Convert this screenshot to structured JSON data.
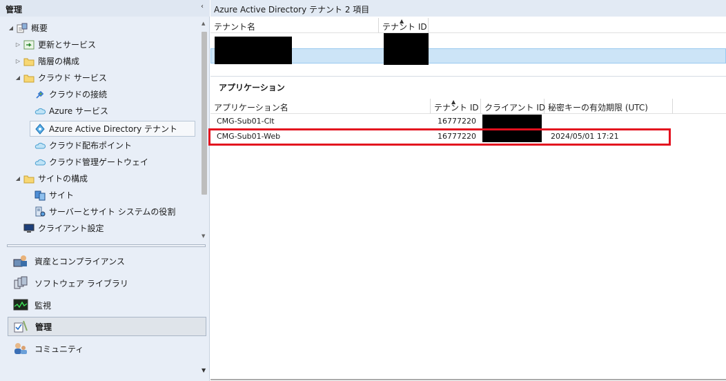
{
  "left": {
    "header": "管理",
    "collapse_icon": "‹",
    "tree": [
      {
        "label": "概要",
        "icon": "overview-icon",
        "expander": "▲",
        "indent": 0
      },
      {
        "label": "更新とサービス",
        "icon": "updates-icon",
        "expander": "▷",
        "indent": 1
      },
      {
        "label": "階層の構成",
        "icon": "folder-icon",
        "expander": "▷",
        "indent": 1
      },
      {
        "label": "クラウド サービス",
        "icon": "folder-icon",
        "expander": "▲",
        "indent": 1
      },
      {
        "label": "クラウドの接続",
        "icon": "cloud-connect-icon",
        "expander": "",
        "indent": 2
      },
      {
        "label": "Azure サービス",
        "icon": "cloud-icon",
        "expander": "",
        "indent": 2
      },
      {
        "label": "Azure Active Directory テナント",
        "icon": "aad-icon",
        "expander": "",
        "indent": 2,
        "selected": true
      },
      {
        "label": "クラウド配布ポイント",
        "icon": "cloud-icon",
        "expander": "",
        "indent": 2
      },
      {
        "label": "クラウド管理ゲートウェイ",
        "icon": "cloud-icon",
        "expander": "",
        "indent": 2
      },
      {
        "label": "サイトの構成",
        "icon": "folder-icon",
        "expander": "▲",
        "indent": 1
      },
      {
        "label": "サイト",
        "icon": "site-icon",
        "expander": "",
        "indent": 2
      },
      {
        "label": "サーバーとサイト システムの役割",
        "icon": "server-role-icon",
        "expander": "",
        "indent": 2
      },
      {
        "label": "クライアント設定",
        "icon": "client-settings-icon",
        "expander": "",
        "indent": 1
      }
    ],
    "workspaces": [
      {
        "label": "資産とコンプライアンス",
        "icon": "assets-icon"
      },
      {
        "label": "ソフトウェア ライブラリ",
        "icon": "software-library-icon"
      },
      {
        "label": "監視",
        "icon": "monitoring-icon"
      },
      {
        "label": "管理",
        "icon": "administration-icon",
        "active": true
      },
      {
        "label": "コミュニティ",
        "icon": "community-icon"
      }
    ]
  },
  "right": {
    "header": "Azure Active Directory テナント 2 項目",
    "tenant_grid": {
      "columns": [
        "テナント名",
        "テナント ID"
      ]
    },
    "apps": {
      "title": "アプリケーション",
      "columns": [
        "アプリケーション名",
        "テナント ID",
        "クライアント ID",
        "秘密キーの有効期限 (UTC)"
      ],
      "rows": [
        {
          "name": "CMG-Sub01-Clt",
          "tenant_id": "16777220",
          "client_id": "",
          "expiry": ""
        },
        {
          "name": "CMG-Sub01-Web",
          "tenant_id": "16777220",
          "client_id": "",
          "expiry": "2024/05/01 17:21"
        }
      ]
    }
  },
  "colors": {
    "highlight": "#e3101e",
    "selection": "#cce4f7",
    "pane_bg": "#e8eef7"
  }
}
